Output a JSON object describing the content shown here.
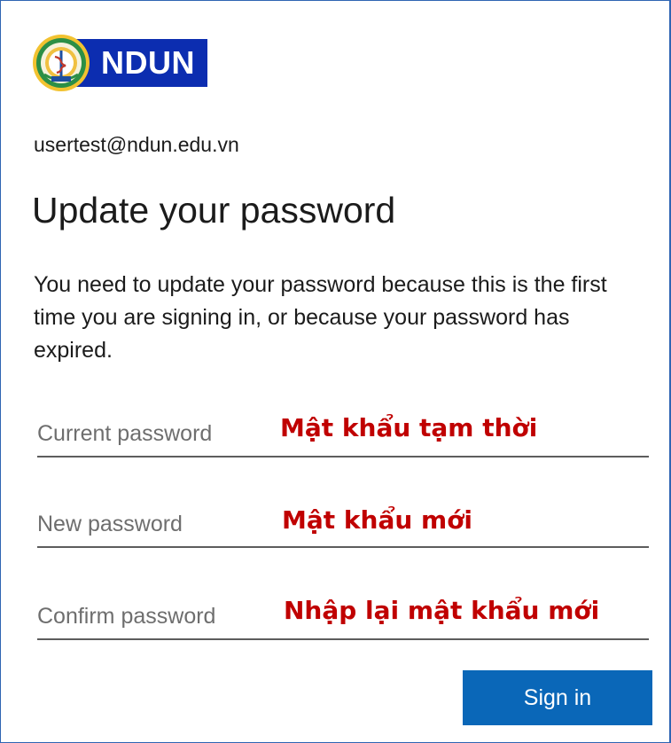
{
  "brand": {
    "logo_text": "NDUN",
    "seal_icon": "university-seal-icon",
    "brand_color": "#0c2db0"
  },
  "account": {
    "email": "usertest@ndun.edu.vn"
  },
  "page": {
    "title": "Update your password",
    "description": "You need to update your password because this is the first time you are signing in, or because your password has expired."
  },
  "form": {
    "current_password": {
      "placeholder": "Current password",
      "annotation": "Mật khẩu tạm thời"
    },
    "new_password": {
      "placeholder": "New password",
      "annotation": "Mật khẩu mới"
    },
    "confirm_password": {
      "placeholder": "Confirm password",
      "annotation": "Nhập lại mật khẩu mới"
    },
    "submit_label": "Sign in"
  },
  "colors": {
    "accent": "#0a67b8",
    "annotation": "#c00000",
    "frame_border": "#2f65b3"
  }
}
